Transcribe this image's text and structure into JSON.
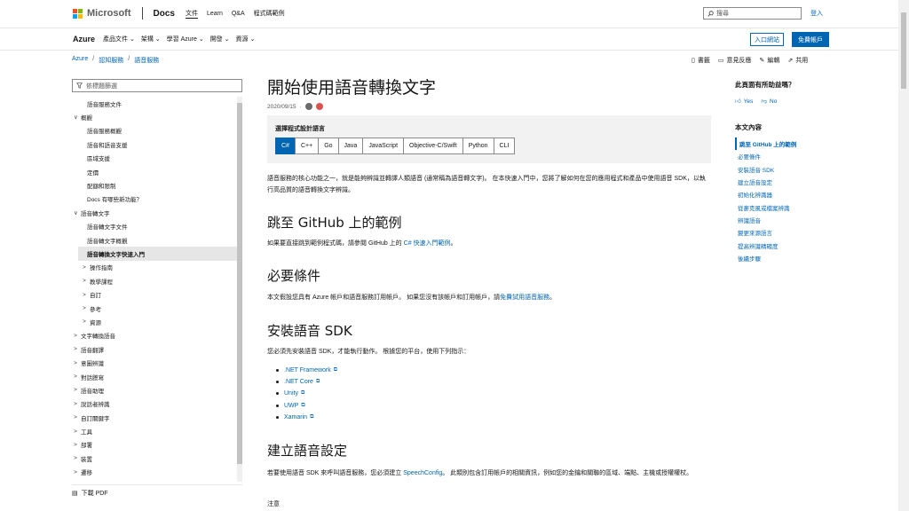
{
  "header": {
    "brand": "Microsoft",
    "docs": "Docs",
    "links": [
      "文件",
      "Learn",
      "Q&A",
      "程式碼範例"
    ],
    "search_placeholder": "搜尋",
    "signin": "登入"
  },
  "nav": {
    "product": "Azure",
    "items": [
      "產品文件",
      "架構",
      "學習 Azure",
      "開發",
      "資源"
    ],
    "portal_button": "入口網站",
    "free_button": "免費帳戶"
  },
  "breadcrumb": [
    "Azure",
    "認知服務",
    "語音服務"
  ],
  "actions": [
    "書籤",
    "意見反應",
    "編輯",
    "共用"
  ],
  "sidebar": {
    "filter_placeholder": "依標題篩選",
    "items": [
      {
        "label": "語音服務文件",
        "level": 2,
        "chev": ""
      },
      {
        "label": "概觀",
        "level": 1,
        "chev": "∨"
      },
      {
        "label": "語音服務概觀",
        "level": 2,
        "chev": ""
      },
      {
        "label": "語音和語音支援",
        "level": 2,
        "chev": ""
      },
      {
        "label": "區域支援",
        "level": 2,
        "chev": ""
      },
      {
        "label": "定價",
        "level": 2,
        "chev": ""
      },
      {
        "label": "配額和限制",
        "level": 2,
        "chev": ""
      },
      {
        "label": "Docs 有哪些新功能？",
        "level": 2,
        "chev": ""
      },
      {
        "label": "語音轉文字",
        "level": 1,
        "chev": "∨"
      },
      {
        "label": "語音轉文字文件",
        "level": 2,
        "chev": ""
      },
      {
        "label": "語音轉文字概觀",
        "level": 2,
        "chev": ""
      },
      {
        "label": "語音轉換文字快速入門",
        "level": 2,
        "chev": "",
        "active": true
      },
      {
        "label": "操作指南",
        "level": 3,
        "chev": ">"
      },
      {
        "label": "教學課程",
        "level": 3,
        "chev": ">"
      },
      {
        "label": "自訂",
        "level": 3,
        "chev": ">"
      },
      {
        "label": "參考",
        "level": 3,
        "chev": ">"
      },
      {
        "label": "資源",
        "level": 3,
        "chev": ">"
      },
      {
        "label": "文字轉換語音",
        "level": 1,
        "chev": ">"
      },
      {
        "label": "語音翻譯",
        "level": 1,
        "chev": ">"
      },
      {
        "label": "意圖辨識",
        "level": 1,
        "chev": ">"
      },
      {
        "label": "對話謄寫",
        "level": 1,
        "chev": ">"
      },
      {
        "label": "語音助理",
        "level": 1,
        "chev": ">"
      },
      {
        "label": "說話者辨識",
        "level": 1,
        "chev": ">"
      },
      {
        "label": "自訂關鍵字",
        "level": 1,
        "chev": ">"
      },
      {
        "label": "工具",
        "level": 1,
        "chev": ">"
      },
      {
        "label": "部署",
        "level": 1,
        "chev": ">"
      },
      {
        "label": "裝置",
        "level": 1,
        "chev": ">"
      },
      {
        "label": "遷移",
        "level": 1,
        "chev": ">"
      }
    ],
    "download": "下載 PDF"
  },
  "article": {
    "title": "開始使用語音轉換文字",
    "date": "2020/09/15",
    "lang_label": "選擇程式設計語言",
    "langs": [
      "C#",
      "C++",
      "Go",
      "Java",
      "JavaScript",
      "Objective-C/Swift",
      "Python",
      "CLI"
    ],
    "intro": "語音服務的核心功能之一，就是能夠辨識並轉譯人類語音 (通常稱為語音轉文字)。 在本快速入門中，您將了解如何在您的應用程式和產品中使用語音 SDK，以執行高品質的語音轉換文字辨識。",
    "h_github": "跳至 GitHub 上的範例",
    "github_text": "如果要直接跳到範例程式碼，請參閱 GitHub 上的",
    "github_link": "C# 快速入門範例",
    "github_end": "。",
    "h_prereq": "必要條件",
    "prereq_text": "本文假設您具有 Azure 帳戶和語音服務訂用帳戶。 如果您沒有該帳戶和訂用帳戶，請",
    "prereq_link": "免費試用語音服務",
    "prereq_end": "。",
    "h_install": "安裝語音 SDK",
    "install_text": "您必須先安裝語音 SDK，才能執行動作。 根據您的平台，使用下列指示：",
    "platforms": [
      ".NET Framework",
      ".NET Core",
      "Unity",
      "UWP",
      "Xamarin"
    ],
    "h_config": "建立語音設定",
    "config_text_a": "若要使用語音 SDK 來呼叫語音服務，您必須建立",
    "config_link": "SpeechConfig",
    "config_text_b": "。 此類別包含訂用帳戶的相關資訊，例如您的金鑰和關聯的區域、端點、主機或授權權杖。",
    "note": "注意"
  },
  "rail": {
    "helpful": "此頁面有所助益嗎？",
    "yes": "Yes",
    "no": "No",
    "toc_title": "本文內容",
    "toc": [
      "跳至 GitHub 上的範例",
      "必要條件",
      "安裝語音 SDK",
      "建立語音設定",
      "初始化辨識器",
      "從麥克風或檔案辨識",
      "辨識語音",
      "變更來源語言",
      "提高辨識精確度",
      "後續步驟"
    ]
  },
  "colors": {
    "accent": "#0065b3",
    "ms_red": "#f25022",
    "ms_green": "#7fba00",
    "ms_blue": "#00a4ef",
    "ms_yellow": "#ffb900"
  }
}
